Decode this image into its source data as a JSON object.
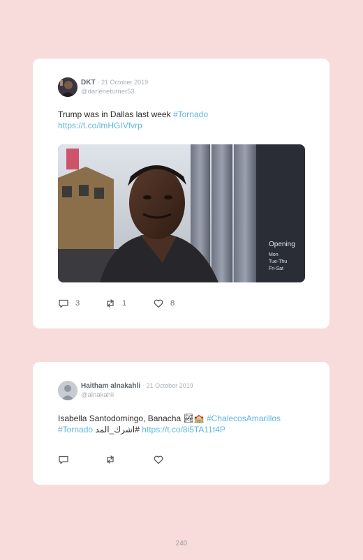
{
  "tweets": [
    {
      "name": "DKT",
      "separator": "·",
      "date": "21 October 2019",
      "handle": "@darleneturner53",
      "text_plain": "Trump was in Dallas last week ",
      "hashtag": "#Tornado",
      "link": "https://t.co/lmHGIVfvrp",
      "replies": "3",
      "retweets": "1",
      "likes": "8",
      "media": "gif-image-man-smirking"
    },
    {
      "name": "Haitham alnakahli",
      "separator": "·",
      "date": "21 October 2019",
      "handle": "@alnakahli",
      "text_plain": "Isabella Santodomingo, Banacha ",
      "emoji": "🏞🏫",
      "hashtag1": "#ChalecosAmarillos",
      "hashtag2": "#Tornado",
      "arabic_tag": "#اشرك_المد",
      "link": "https://t.co/8i5TA11t4P",
      "replies": "",
      "retweets": "",
      "likes": ""
    }
  ],
  "icons": {
    "reply": "reply-icon",
    "retweet": "retweet-icon",
    "like": "heart-icon"
  },
  "page_number": "240",
  "colors": {
    "background": "#f8dcdc",
    "card": "#ffffff",
    "link": "#5fb6e3",
    "muted": "#a9b0b8"
  }
}
